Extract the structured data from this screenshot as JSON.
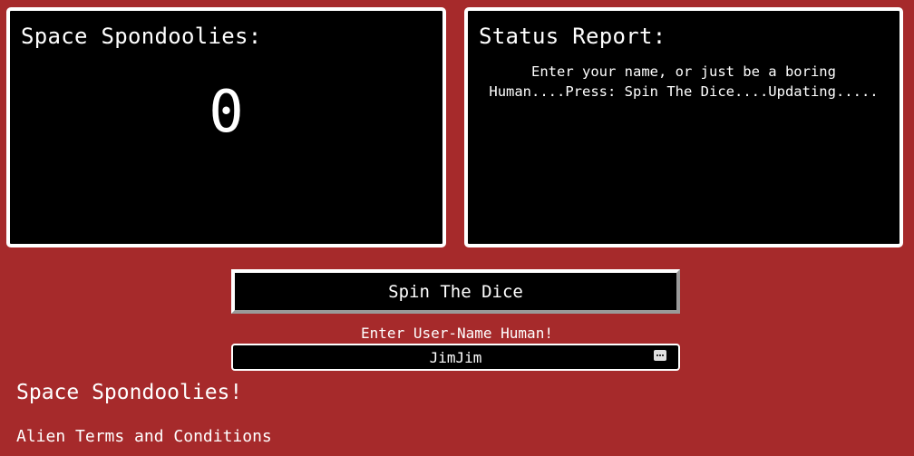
{
  "score_panel": {
    "title": "Space Spondoolies:",
    "value": "0"
  },
  "status_panel": {
    "title": "Status Report:",
    "message": "Enter your name, or just be a boring Human....Press: Spin The Dice....Updating....."
  },
  "spin_button": {
    "label": "Spin The Dice"
  },
  "username": {
    "label": "Enter User-Name Human!",
    "value": "JimJim",
    "icon": "autofill-key-icon"
  },
  "footer": {
    "title": "Space Spondoolies!",
    "terms_link": "Alien Terms and Conditions"
  },
  "colors": {
    "background": "#a62a2b",
    "panel": "#000000",
    "border": "#ffffff"
  }
}
